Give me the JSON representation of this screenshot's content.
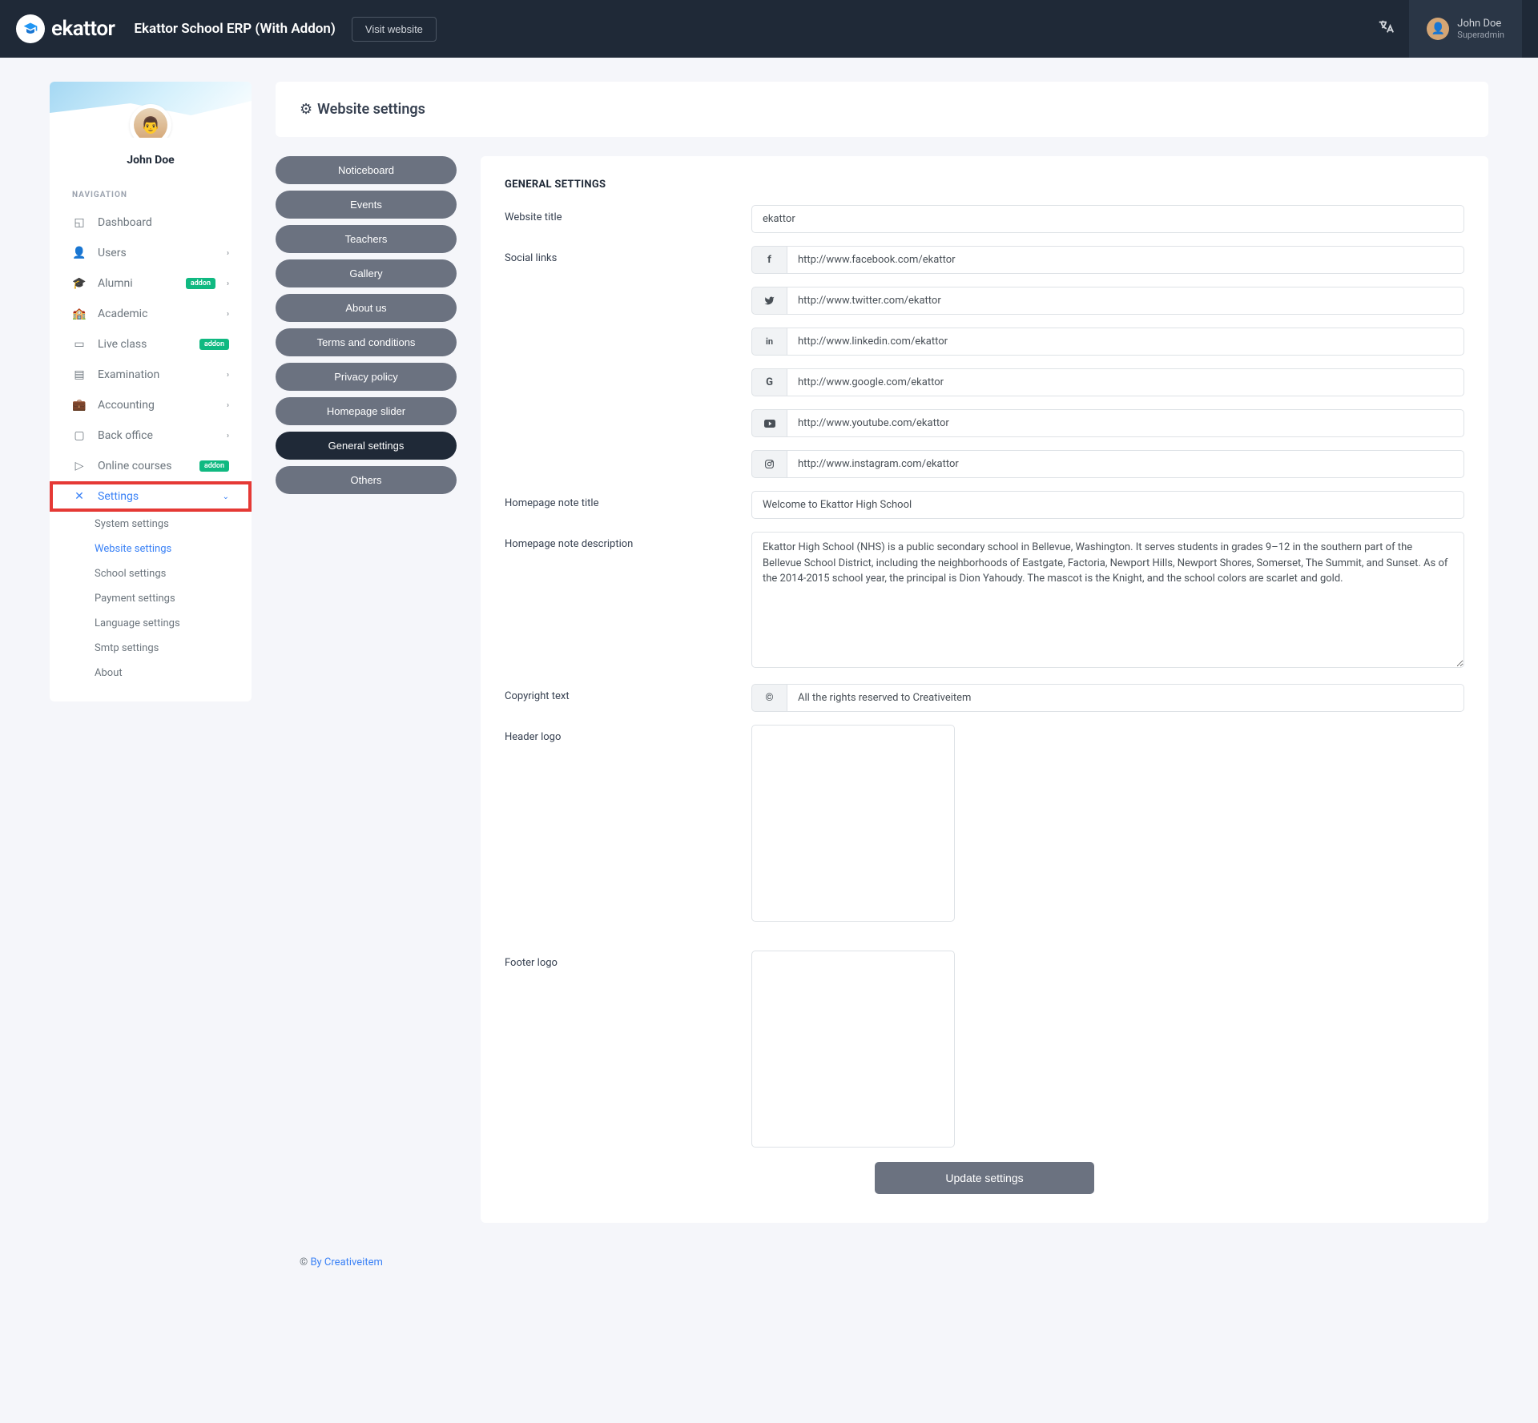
{
  "brand": {
    "name": "ekattor"
  },
  "header": {
    "title": "Ekattor School ERP (With Addon)",
    "visit_btn": "Visit website"
  },
  "user": {
    "name": "John Doe",
    "role": "Superadmin"
  },
  "sidebar": {
    "profile_name": "John Doe",
    "nav_heading": "NAVIGATION",
    "items": [
      {
        "label": "Dashboard"
      },
      {
        "label": "Users"
      },
      {
        "label": "Alumni",
        "addon": "addon"
      },
      {
        "label": "Academic"
      },
      {
        "label": "Live class",
        "addon": "addon"
      },
      {
        "label": "Examination"
      },
      {
        "label": "Accounting"
      },
      {
        "label": "Back office"
      },
      {
        "label": "Online courses",
        "addon": "addon"
      },
      {
        "label": "Settings"
      }
    ],
    "sub": [
      {
        "label": "System settings"
      },
      {
        "label": "Website settings"
      },
      {
        "label": "School settings"
      },
      {
        "label": "Payment settings"
      },
      {
        "label": "Language settings"
      },
      {
        "label": "Smtp settings"
      },
      {
        "label": "About"
      }
    ]
  },
  "page": {
    "title": "Website settings"
  },
  "pills": [
    "Noticeboard",
    "Events",
    "Teachers",
    "Gallery",
    "About us",
    "Terms and conditions",
    "Privacy policy",
    "Homepage slider",
    "General settings",
    "Others"
  ],
  "form": {
    "heading": "GENERAL SETTINGS",
    "labels": {
      "website_title": "Website title",
      "social_links": "Social links",
      "homepage_note_title": "Homepage note title",
      "homepage_note_desc": "Homepage note description",
      "copyright": "Copyright text",
      "header_logo": "Header logo",
      "footer_logo": "Footer logo"
    },
    "values": {
      "website_title": "ekattor",
      "facebook": "http://www.facebook.com/ekattor",
      "twitter": "http://www.twitter.com/ekattor",
      "linkedin": "http://www.linkedin.com/ekattor",
      "google": "http://www.google.com/ekattor",
      "youtube": "http://www.youtube.com/ekattor",
      "instagram": "http://www.instagram.com/ekattor",
      "homepage_note_title": "Welcome to Ekattor High School",
      "homepage_note_desc": "Ekattor High School (NHS) is a public secondary school in Bellevue, Washington. It serves students in grades 9–12 in the southern part of the Bellevue School District, including the neighborhoods of Eastgate, Factoria, Newport Hills, Newport Shores, Somerset, The Summit, and Sunset. As of the 2014-2015 school year, the principal is Dion Yahoudy. The mascot is the Knight, and the school colors are scarlet and gold.",
      "copyright": "All the rights reserved to Creativeitem"
    },
    "submit": "Update settings"
  },
  "footer": {
    "prefix": "© ",
    "link": "By Creativeitem"
  }
}
